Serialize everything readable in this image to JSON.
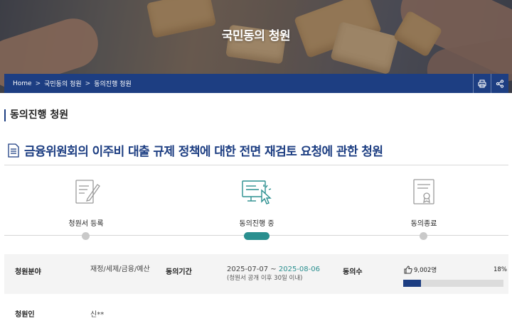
{
  "hero": {
    "title": "국민동의 청원"
  },
  "breadcrumb": {
    "items": [
      "Home",
      "국민동의 청원",
      "동의진행 청원"
    ]
  },
  "actions": {
    "print_icon": "print-icon",
    "share_icon": "share-icon"
  },
  "section": {
    "title": "동의진행 청원"
  },
  "petition": {
    "title": "금융위원회의 이주비 대출 규제 정책에 대한 전면 재검토 요청에 관한 청원"
  },
  "steps": [
    {
      "label": "청원서 등록",
      "icon": "write-document-icon",
      "active": false
    },
    {
      "label": "동의진행 중",
      "icon": "computer-click-icon",
      "active": true
    },
    {
      "label": "동의종료",
      "icon": "certificate-icon",
      "active": false
    }
  ],
  "info": {
    "field_label": "청원분야",
    "field_value": "재정/세제/금융/예산",
    "period_label": "동의기간",
    "period_start": "2025-07-07 ~ ",
    "period_end": "2025-08-06",
    "period_note": "(청원서 공개 이후 30일 이내)",
    "count_label": "동의수",
    "count_value": "9,002명",
    "percent_text": "18%",
    "progress": 0.18,
    "petitioner_label": "청원인",
    "petitioner_value": "신**"
  },
  "colors": {
    "navy": "#1d3e82",
    "teal": "#2a8f8f"
  }
}
